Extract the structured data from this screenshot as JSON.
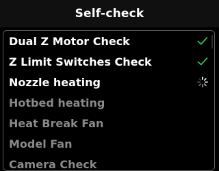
{
  "header": {
    "title": "Self-check"
  },
  "colors": {
    "background": "#000000",
    "title_bar": "#101010",
    "active_text": "#ffffff",
    "pending_text": "#8a8a8a",
    "success": "#29c25a",
    "border": "#5f5f5f"
  },
  "checks": [
    {
      "label": "Dual Z Motor Check",
      "state": "passed",
      "icon": "checkmark-icon"
    },
    {
      "label": "Z Limit Switches Check",
      "state": "passed",
      "icon": "checkmark-icon"
    },
    {
      "label": "Nozzle heating",
      "state": "in-progress",
      "icon": "spinner-icon"
    },
    {
      "label": "Hotbed heating",
      "state": "pending",
      "icon": ""
    },
    {
      "label": "Heat Break Fan",
      "state": "pending",
      "icon": ""
    },
    {
      "label": "Model Fan",
      "state": "pending",
      "icon": ""
    },
    {
      "label": "Camera Check",
      "state": "pending",
      "icon": ""
    }
  ]
}
